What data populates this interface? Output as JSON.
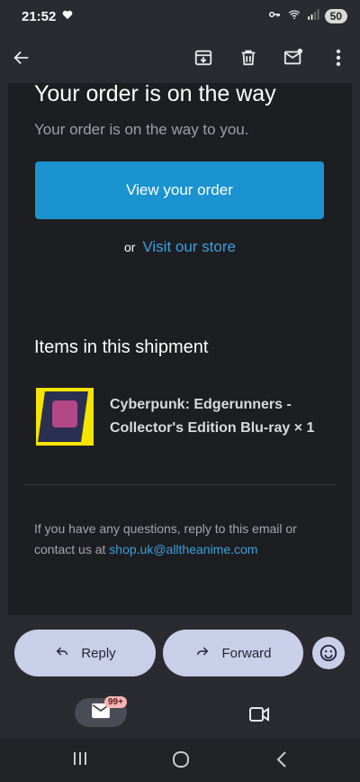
{
  "status": {
    "time": "21:52",
    "battery": "50"
  },
  "email": {
    "title": "Your order is on the way",
    "subtitle": "Your order is on the way to you.",
    "view_button": "View your order",
    "or_text": "or",
    "store_link": "Visit our store",
    "section_title": "Items in this shipment",
    "item_name": "Cyberpunk: Edgerunners - Collector's Edition Blu-ray × 1",
    "footer_text": "If you have any questions, reply to this email or contact us at",
    "footer_email": "shop.uk@alltheanime.com"
  },
  "actions": {
    "reply": "Reply",
    "forward": "Forward"
  },
  "bottom_nav": {
    "mail_badge": "99+"
  },
  "colors": {
    "accent": "#1a93d0",
    "link": "#3ba0de",
    "pill": "#c9cfe9"
  },
  "icons": [
    "back-arrow-icon",
    "archive-icon",
    "trash-icon",
    "mark-unread-icon",
    "more-vert-icon",
    "reply-icon",
    "forward-icon",
    "emoji-icon",
    "mail-icon",
    "video-icon"
  ]
}
